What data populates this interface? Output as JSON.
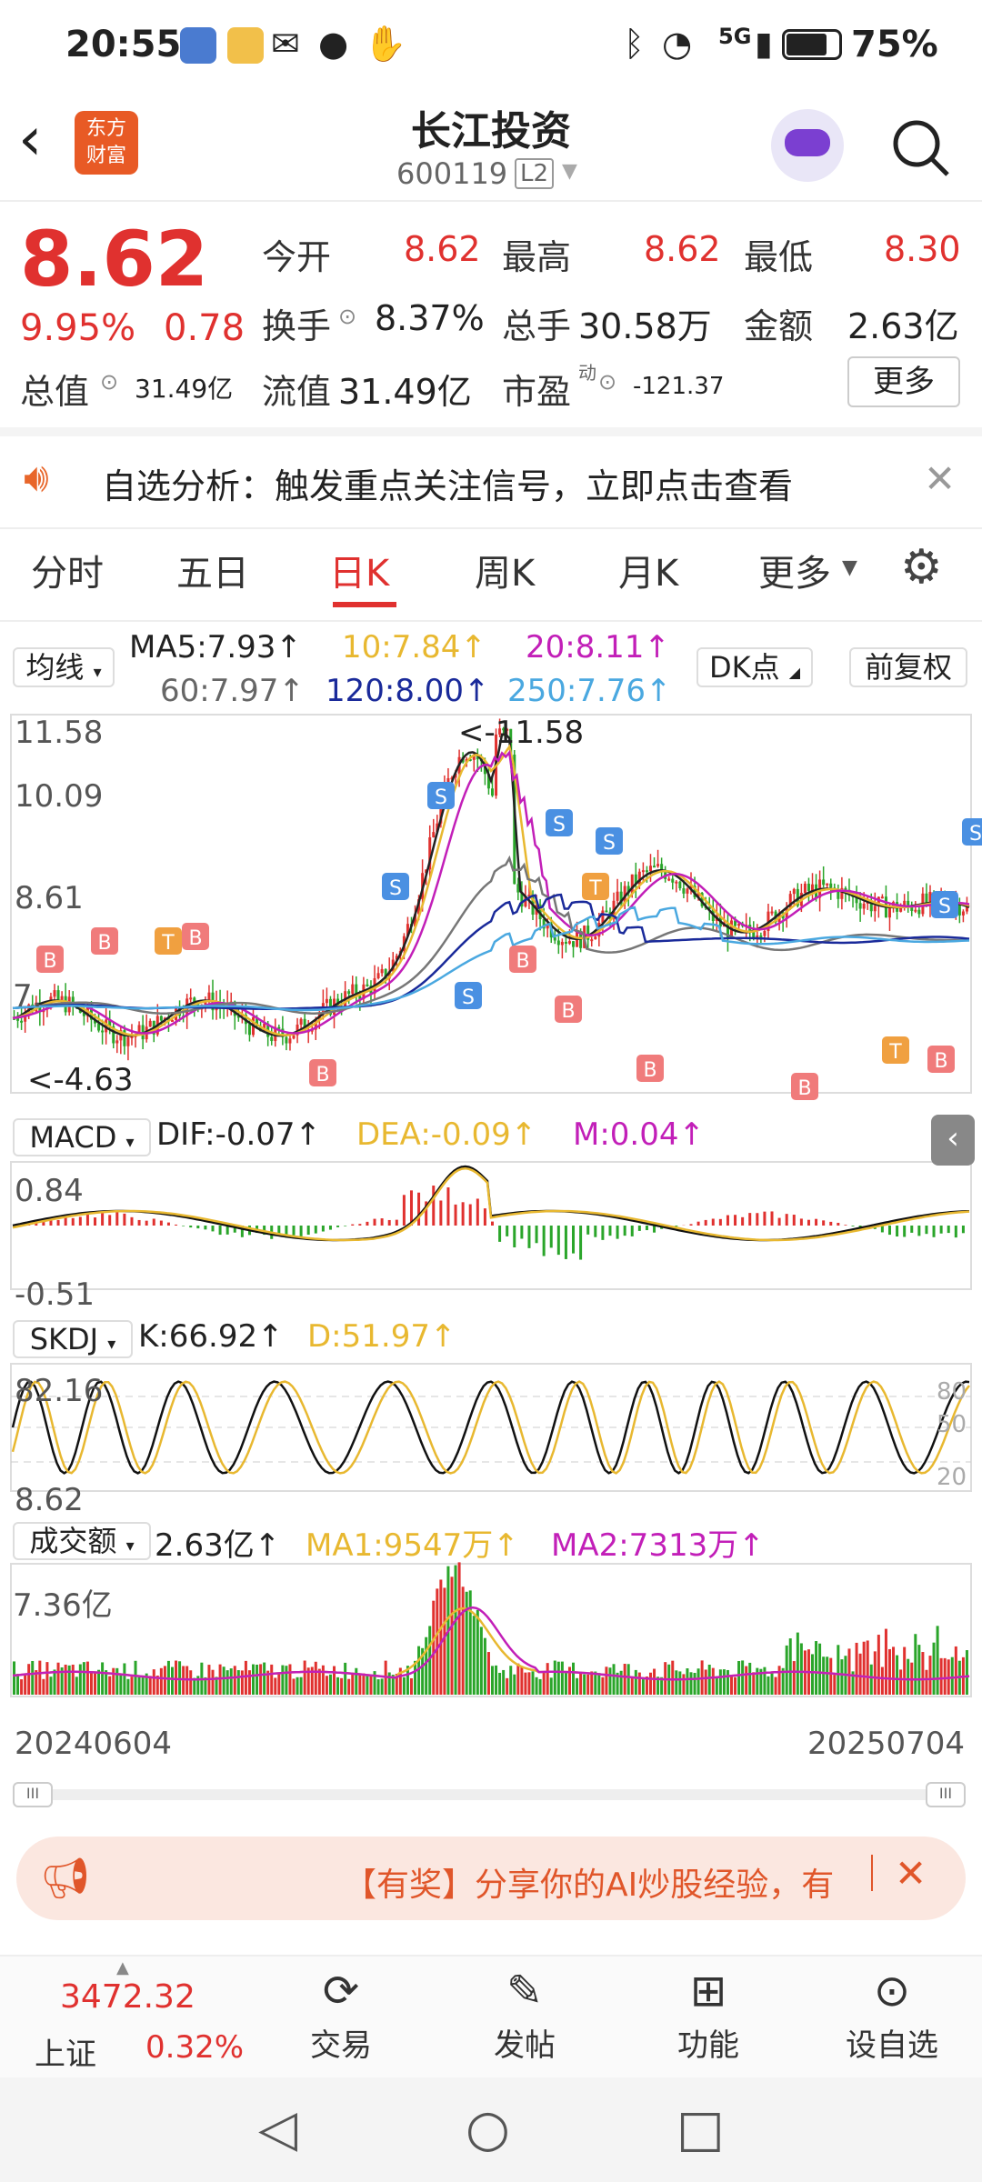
{
  "status_bar": {
    "time": "20:55",
    "battery": "75%",
    "network": "5G"
  },
  "header": {
    "brand_line1": "东方",
    "brand_line2": "财富",
    "title": "长江投资",
    "code": "600119",
    "level": "L2"
  },
  "quote": {
    "price": "8.62",
    "change_pct": "9.95%",
    "change": "0.78",
    "open_label": "今开",
    "open": "8.62",
    "high_label": "最高",
    "high": "8.62",
    "low_label": "最低",
    "low": "8.30",
    "turnover_label": "换手",
    "turnover": "8.37%",
    "volume_label": "总手",
    "volume": "30.58万",
    "amount_label": "金额",
    "amount": "2.63亿",
    "mktcap_label": "总值",
    "mktcap": "31.49亿",
    "float_label": "流值",
    "float_cap": "31.49亿",
    "pe_label": "市盈",
    "pe_sup": "动",
    "pe": "-121.37",
    "more": "更多"
  },
  "banner": {
    "text": "自选分析：触发重点关注信号，立即点击查看"
  },
  "tabs": [
    "分时",
    "五日",
    "日K",
    "周K",
    "月K",
    "更多"
  ],
  "active_tab": 2,
  "ma_bar": {
    "select": "均线",
    "ma5": "MA5:7.93↑",
    "ma10": "10:7.84↑",
    "ma20": "20:8.11↑",
    "ma60": "60:7.97↑",
    "ma120": "120:8.00↑",
    "ma250": "250:7.76↑",
    "dk": "DK点",
    "fq": "前复权"
  },
  "kline": {
    "y_top": "11.58",
    "y_mid1": "10.09",
    "y_mid2": "8.61",
    "y_bot": "4.63",
    "max_marker": "<-11.58",
    "min_marker": "<-4.63",
    "left_cut": "7."
  },
  "macd": {
    "select": "MACD",
    "dif": "DIF:-0.07↑",
    "dea": "DEA:-0.09↑",
    "m": "M:0.04↑",
    "y_top": "0.84",
    "y_bot": "-0.51"
  },
  "kdj": {
    "select": "SKDJ",
    "k": "K:66.92↑",
    "d": "D:51.97↑",
    "y_top": "82.16",
    "y_bot": "8.62",
    "r80": "80",
    "r50": "50",
    "r20": "20"
  },
  "volume_ind": {
    "select": "成交额",
    "value": "2.63亿↑",
    "ma1": "MA1:9547万↑",
    "ma2": "MA2:7313万↑",
    "y_top": "7.36亿"
  },
  "dates": {
    "start": "20240604",
    "end": "20250704"
  },
  "promo": {
    "text": "【有奖】分享你的AI炒股经验，有"
  },
  "bottom": {
    "index_value": "3472.32",
    "index_name": "上证",
    "index_change": "0.32%",
    "trade": "交易",
    "post": "发帖",
    "func": "功能",
    "watch": "设自选"
  },
  "colors": {
    "up": "#e0312f",
    "down": "#2aa52a",
    "ma5": "#222222",
    "ma10": "#e8b830",
    "ma20": "#c21fb8",
    "ma60": "#777777",
    "ma120": "#1a2a9a",
    "ma250": "#4aa8e0"
  }
}
